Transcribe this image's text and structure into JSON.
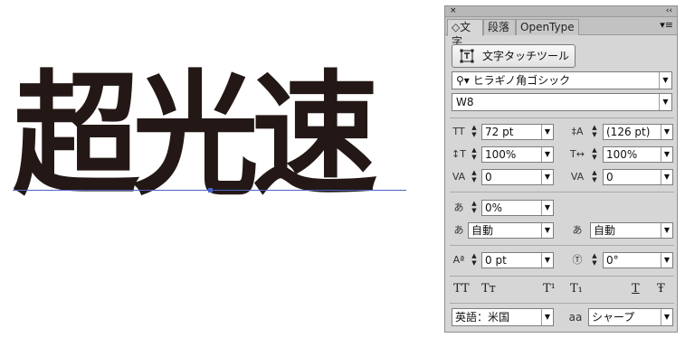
{
  "canvas": {
    "sample_text": "超光速",
    "text_color": "#231815",
    "baseline_color": "#4a63c8"
  },
  "panel": {
    "close_glyph": "×",
    "collapse_glyph": "‹‹",
    "menu_glyph": "▾≡",
    "tabs": [
      {
        "label": "◇文字",
        "active": true
      },
      {
        "label": "段落",
        "active": false
      },
      {
        "label": "OpenType",
        "active": false
      }
    ],
    "touch_button_label": "文字タッチツール",
    "font_family": "ヒラギノ角ゴシック",
    "font_weight": "W8",
    "font_size": "72 pt",
    "leading": "(126 pt)",
    "vertical_scale": "100%",
    "horizontal_scale": "100%",
    "kerning": "0",
    "tracking": "0",
    "tsume": "0%",
    "aki_left": "自動",
    "aki_right": "自動",
    "baseline_shift": "0 pt",
    "char_rotation": "0°",
    "language": "英語：米国",
    "antialias": "シャープ",
    "antialias_icon": "aa",
    "type_styles": [
      "TT",
      "Tт",
      "T¹",
      "T₁",
      "T",
      "Ŧ"
    ]
  }
}
